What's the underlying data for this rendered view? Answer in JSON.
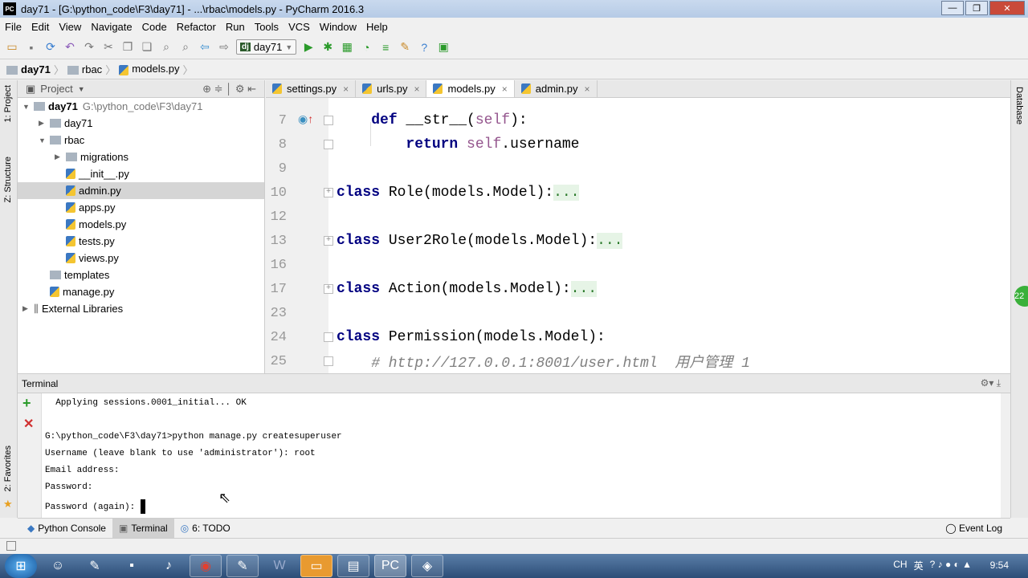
{
  "window": {
    "title": "day71 - [G:\\python_code\\F3\\day71] - ...\\rbac\\models.py - PyCharm 2016.3",
    "logo": "PC"
  },
  "menu": [
    "File",
    "Edit",
    "View",
    "Navigate",
    "Code",
    "Refactor",
    "Run",
    "Tools",
    "VCS",
    "Window",
    "Help"
  ],
  "toolbar": {
    "run_config": "day71",
    "dj": "dj"
  },
  "breadcrumb": [
    "day71",
    "rbac",
    "models.py"
  ],
  "left_strip": {
    "project": "1: Project",
    "structure": "Z: Structure",
    "favorites": "2: Favorites"
  },
  "right_strip": {
    "database": "Database",
    "badge": "22"
  },
  "project": {
    "header": "Project",
    "tree": [
      {
        "label": "day71",
        "path": "G:\\python_code\\F3\\day71",
        "type": "folder",
        "depth": 0,
        "expanded": true
      },
      {
        "label": "day71",
        "type": "folder",
        "depth": 1,
        "expanded": false
      },
      {
        "label": "rbac",
        "type": "folder",
        "depth": 1,
        "expanded": true
      },
      {
        "label": "migrations",
        "type": "folder",
        "depth": 2,
        "expanded": false
      },
      {
        "label": "__init__.py",
        "type": "py",
        "depth": 2
      },
      {
        "label": "admin.py",
        "type": "py",
        "depth": 2,
        "selected": true
      },
      {
        "label": "apps.py",
        "type": "py",
        "depth": 2
      },
      {
        "label": "models.py",
        "type": "py",
        "depth": 2
      },
      {
        "label": "tests.py",
        "type": "py",
        "depth": 2
      },
      {
        "label": "views.py",
        "type": "py",
        "depth": 2
      },
      {
        "label": "templates",
        "type": "folder",
        "depth": 1
      },
      {
        "label": "manage.py",
        "type": "py",
        "depth": 1
      },
      {
        "label": "External Libraries",
        "type": "lib",
        "depth": 0,
        "expanded": false
      }
    ]
  },
  "tabs": [
    {
      "label": "settings.py"
    },
    {
      "label": "urls.py"
    },
    {
      "label": "models.py",
      "active": true
    },
    {
      "label": "admin.py"
    }
  ],
  "editor": {
    "lines": [
      {
        "n": "7",
        "parts": [
          [
            "    ",
            ""
          ],
          [
            "def",
            "kw"
          ],
          [
            " __str__(",
            ""
          ],
          [
            "self",
            "slf"
          ],
          [
            "):",
            ""
          ]
        ]
      },
      {
        "n": "8",
        "parts": [
          [
            "        ",
            ""
          ],
          [
            "return",
            "kw"
          ],
          [
            " ",
            ""
          ],
          [
            "self",
            "slf"
          ],
          [
            ".username",
            ""
          ]
        ]
      },
      {
        "n": "9",
        "parts": []
      },
      {
        "n": "10",
        "parts": [
          [
            "class",
            "kw"
          ],
          [
            " Role(models.Model):",
            ""
          ],
          [
            "...",
            "fold"
          ]
        ]
      },
      {
        "n": "12",
        "parts": []
      },
      {
        "n": "13",
        "parts": [
          [
            "class",
            "kw"
          ],
          [
            " User2Role(models.Model):",
            ""
          ],
          [
            "...",
            "fold"
          ]
        ]
      },
      {
        "n": "16",
        "parts": []
      },
      {
        "n": "17",
        "parts": [
          [
            "class",
            "kw"
          ],
          [
            " Action(models.Model):",
            ""
          ],
          [
            "...",
            "fold"
          ]
        ]
      },
      {
        "n": "23",
        "parts": []
      },
      {
        "n": "24",
        "parts": [
          [
            "class",
            "kw"
          ],
          [
            " Permission(models.Model):",
            ""
          ]
        ]
      },
      {
        "n": "25",
        "parts": [
          [
            "    # http://127.0.0.1:8001/user.html  用户管理 1",
            "cmt"
          ]
        ]
      }
    ]
  },
  "terminal": {
    "title": "Terminal",
    "lines": [
      "  Applying sessions.0001_initial... OK",
      "",
      "G:\\python_code\\F3\\day71>python manage.py createsuperuser",
      "Username (leave blank to use 'administrator'): root",
      "Email address:",
      "Password:",
      "Password (again): "
    ]
  },
  "bottom_tabs": [
    {
      "label": "Python Console"
    },
    {
      "label": "Terminal",
      "active": true
    },
    {
      "label": "6: TODO"
    }
  ],
  "event_log": "Event Log",
  "taskbar": {
    "clock": "9:54",
    "tray": [
      "CH",
      "英"
    ]
  }
}
